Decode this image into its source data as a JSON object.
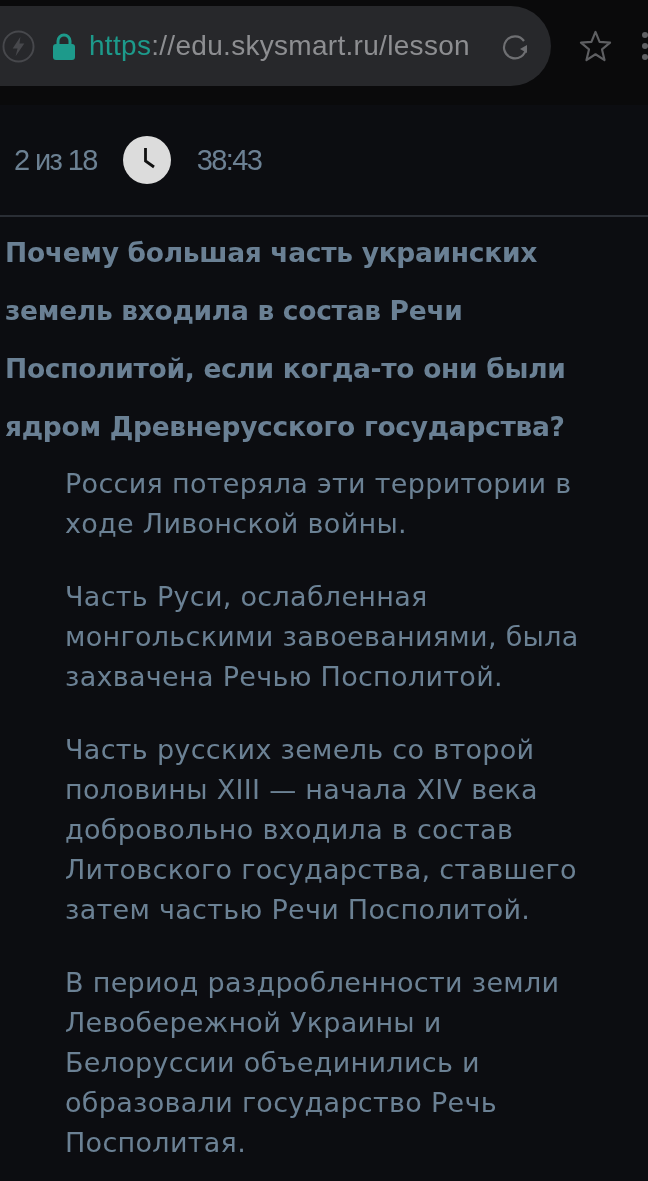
{
  "browser": {
    "url_scheme": "https",
    "url_rest": "://edu.skysmart.ru/lesson"
  },
  "progress": {
    "position": "2 из 18",
    "timer": "38:43"
  },
  "question": "Почему большая часть украинских земель входила в состав Речи Посполитой, если когда-то они были ядром Древнерусского государства?",
  "answers": [
    "Россия потеряла эти территории в ходе Ливонской войны.",
    "Часть Руси, ослабленная монгольскими завоеваниями, была захвачена Речью Посполитой.",
    "Часть русских земель со второй половины XIII — начала XIV века добровольно входила в состав Литовского государства, ставшего затем частью Речи Посполитой.",
    "В период раздробленности земли Левобережной Украины и Белоруссии объединились и образовали государство Речь Посполитая."
  ]
}
